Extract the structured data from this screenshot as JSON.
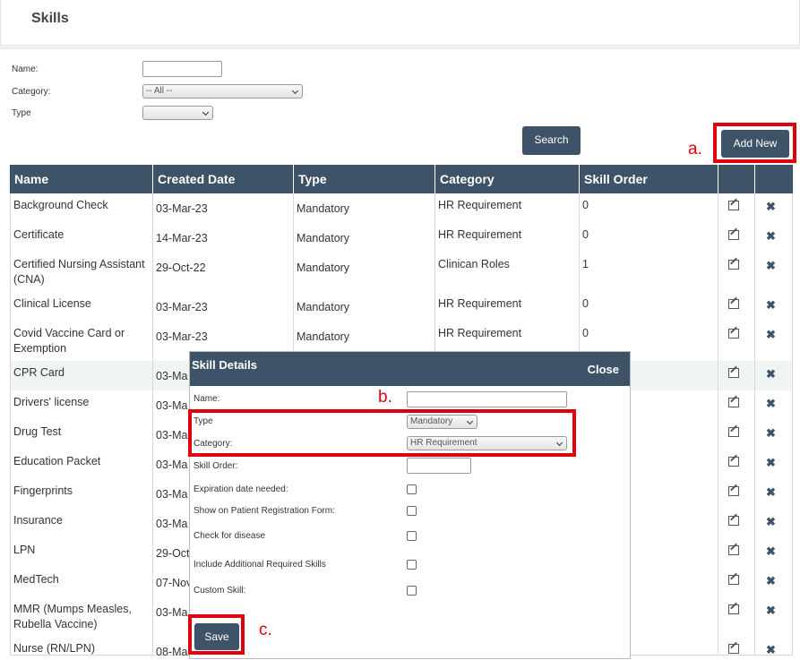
{
  "page": {
    "title": "Skills"
  },
  "filters": {
    "name_label": "Name:",
    "category_label": "Category:",
    "category_value": "-- All --",
    "type_label": "Type",
    "type_value": ""
  },
  "buttons": {
    "search": "Search",
    "add_new": "Add New"
  },
  "table": {
    "headers": [
      "Name",
      "Created Date",
      "Type",
      "Category",
      "Skill Order",
      "",
      ""
    ],
    "rows": [
      {
        "name": "Background Check",
        "date": "03-Mar-23",
        "type": "Mandatory",
        "category": "HR Requirement",
        "order": "0"
      },
      {
        "name": "Certificate",
        "date": "14-Mar-23",
        "type": "Mandatory",
        "category": "HR Requirement",
        "order": "0"
      },
      {
        "name": "Certified Nursing Assistant (CNA)",
        "date": "29-Oct-22",
        "type": "Mandatory",
        "category": "Clinican Roles",
        "order": "1"
      },
      {
        "name": "Clinical License",
        "date": "03-Mar-23",
        "type": "Mandatory",
        "category": "HR Requirement",
        "order": "0"
      },
      {
        "name": "Covid Vaccine Card or Exemption",
        "date": "03-Mar-23",
        "type": "Mandatory",
        "category": "HR Requirement",
        "order": "0"
      },
      {
        "name": "CPR Card",
        "date": "03-Ma",
        "type": "",
        "category": "",
        "order": ""
      },
      {
        "name": "Drivers' license",
        "date": "03-Ma",
        "type": "",
        "category": "",
        "order": ""
      },
      {
        "name": "Drug Test",
        "date": "03-Ma",
        "type": "",
        "category": "",
        "order": ""
      },
      {
        "name": "Education Packet",
        "date": "03-Ma",
        "type": "",
        "category": "",
        "order": ""
      },
      {
        "name": "Fingerprints",
        "date": "03-Ma",
        "type": "",
        "category": "",
        "order": ""
      },
      {
        "name": "Insurance",
        "date": "03-Ma",
        "type": "",
        "category": "",
        "order": ""
      },
      {
        "name": "LPN",
        "date": "29-Oct",
        "type": "",
        "category": "",
        "order": ""
      },
      {
        "name": "MedTech",
        "date": "07-Nov",
        "type": "",
        "category": "",
        "order": ""
      },
      {
        "name": "MMR (Mumps Measles, Rubella Vaccine)",
        "date": "03-Ma",
        "type": "",
        "category": "",
        "order": ""
      },
      {
        "name": "Nurse (RN/LPN)",
        "date": "08-Ma",
        "type": "",
        "category": "",
        "order": ""
      }
    ]
  },
  "modal": {
    "title": "Skill Details",
    "close": "Close",
    "name_label": "Name:",
    "type_label": "Type",
    "type_value": "Mandatory",
    "category_label": "Category:",
    "category_value": "HR Requirement",
    "skill_order_label": "Skill Order:",
    "expiration_label": "Expiration date needed:",
    "patient_form_label": "Show on Patient Registration Form:",
    "disease_label": "Check for disease",
    "additional_label": "Include Additional Required Skills",
    "custom_label": "Custom Skill:",
    "save": "Save"
  },
  "annotations": {
    "a": "a.",
    "b": "b.",
    "c": "c."
  },
  "colors": {
    "header_bg": "#3e5368",
    "highlight": "#e0000d",
    "alt_row": "#eef5f2"
  },
  "icons": {
    "edit": "edit-icon",
    "delete": "delete-icon"
  }
}
